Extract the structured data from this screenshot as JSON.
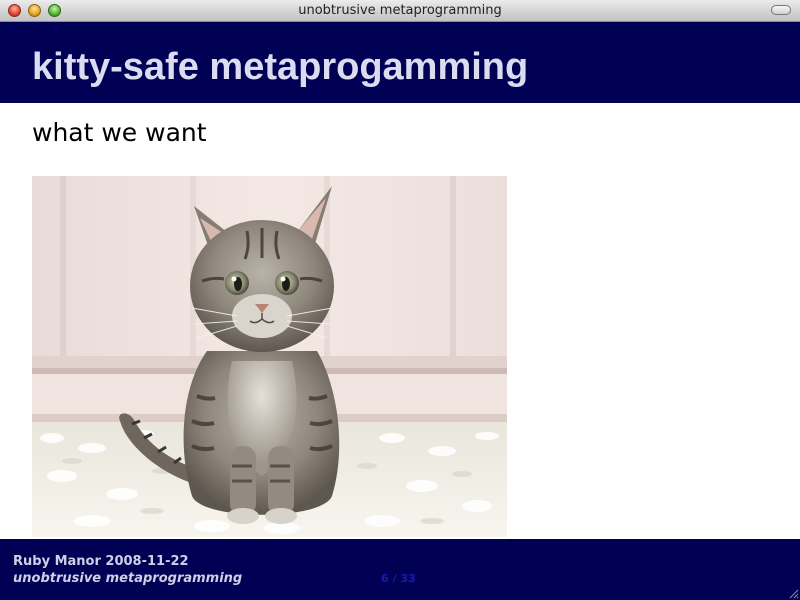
{
  "window": {
    "title": "unobtrusive metaprogramming"
  },
  "slide": {
    "title": "kitty-safe metaprogamming",
    "subtitle": "what we want",
    "image": {
      "icon": "kitten-photo",
      "subject": "tabby kitten"
    }
  },
  "footer": {
    "line1": "Ruby Manor 2008-11-22",
    "line2": "unobtrusive metaprogramming",
    "counter": "6 / 33"
  },
  "colors": {
    "header_bg": "#000055",
    "title_text": "#dcdcf0",
    "counter_text": "#1a1ab0"
  }
}
